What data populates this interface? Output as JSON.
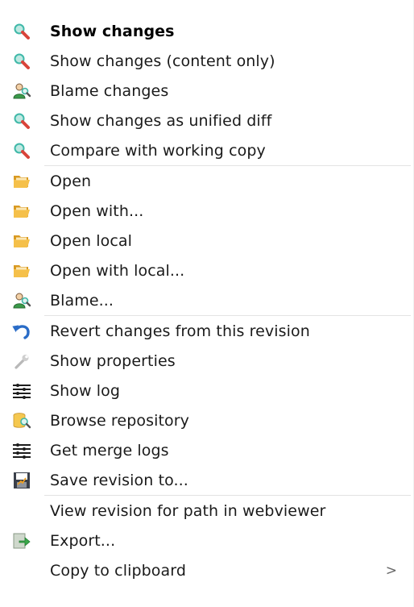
{
  "menu": {
    "group1": [
      {
        "label": "Show changes",
        "bold": true,
        "icon": "magnifier-red-icon"
      },
      {
        "label": "Show changes (content only)",
        "icon": "magnifier-red-icon"
      },
      {
        "label": "Blame changes",
        "icon": "blame-user-icon"
      },
      {
        "label": "Show changes as unified diff",
        "icon": "magnifier-red-icon"
      },
      {
        "label": "Compare with working copy",
        "icon": "magnifier-red-icon"
      }
    ],
    "group2": [
      {
        "label": "Open",
        "icon": "folder-open-icon"
      },
      {
        "label": "Open with...",
        "icon": "folder-open-icon"
      },
      {
        "label": "Open local",
        "icon": "folder-open-icon"
      },
      {
        "label": "Open with local...",
        "icon": "folder-open-icon"
      },
      {
        "label": "Blame...",
        "icon": "blame-user-icon"
      }
    ],
    "group3": [
      {
        "label": "Revert changes from this revision",
        "icon": "revert-arrow-icon"
      },
      {
        "label": "Show properties",
        "icon": "wrench-icon"
      },
      {
        "label": "Show log",
        "icon": "log-icon"
      },
      {
        "label": "Browse repository",
        "icon": "repository-browser-icon"
      },
      {
        "label": "Get merge logs",
        "icon": "log-icon"
      },
      {
        "label": "Save revision to...",
        "icon": "save-icon"
      }
    ],
    "group4": [
      {
        "label": "View revision for path in webviewer",
        "icon": ""
      },
      {
        "label": "Export...",
        "icon": "export-icon"
      },
      {
        "label": "Copy to clipboard",
        "icon": "",
        "submenu_arrow": ">"
      }
    ]
  },
  "colors": {
    "magnifier_lens": "#3fb8a8",
    "magnifier_handle": "#d9443a",
    "folder": "#f0b73c",
    "revert": "#2a6cc7"
  }
}
